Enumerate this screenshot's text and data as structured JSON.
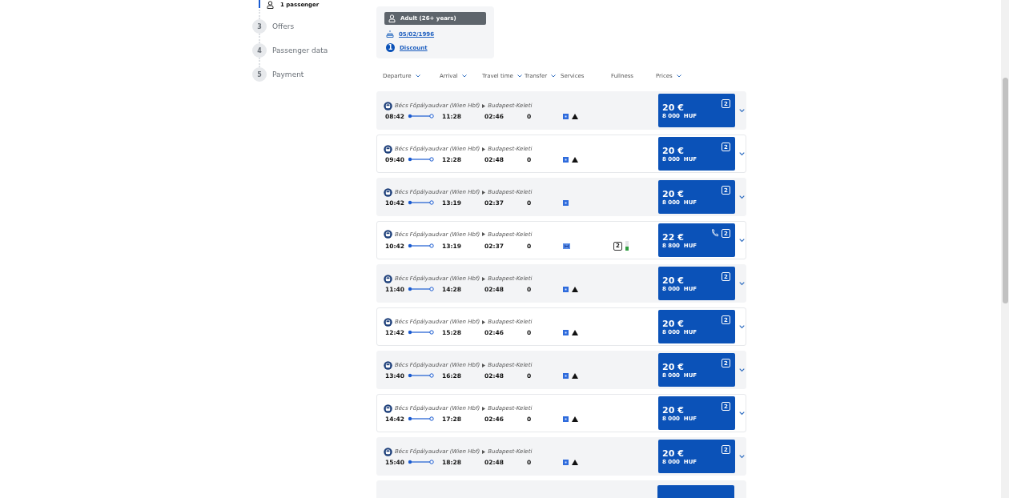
{
  "stepper": {
    "current_label": "1 passenger",
    "steps": [
      {
        "number": "3",
        "label": "Offers"
      },
      {
        "number": "4",
        "label": "Passenger data"
      },
      {
        "number": "5",
        "label": "Payment"
      }
    ]
  },
  "passenger_card": {
    "type": "Adult (26+ years)",
    "birth_date": "05/02/1996",
    "discount_count": "1",
    "discount_label": "Discount"
  },
  "columns": [
    {
      "label": "Departure",
      "sortable": true
    },
    {
      "label": "Arrival",
      "sortable": true
    },
    {
      "label": "Travel time",
      "sortable": true
    },
    {
      "label": "Transfer",
      "sortable": true
    },
    {
      "label": "Services",
      "sortable": false
    },
    {
      "label": "Fullness",
      "sortable": false
    },
    {
      "label": "Prices",
      "sortable": true
    }
  ],
  "trips": [
    {
      "from": "Bécs Főpályaudvar (Wien Hbf)",
      "to": "Budapest-Keleti",
      "departure": "08:42",
      "arrival": "11:28",
      "travel_time": "02:46",
      "transfers": "0",
      "services": [
        {
          "kind": "box"
        },
        {
          "kind": "warning"
        }
      ],
      "price": "20 €",
      "price_huf": "8 000  HUF",
      "class": "2",
      "phone": false
    },
    {
      "from": "Bécs Főpályaudvar (Wien Hbf)",
      "to": "Budapest-Keleti",
      "departure": "09:40",
      "arrival": "12:28",
      "travel_time": "02:48",
      "transfers": "0",
      "services": [
        {
          "kind": "box"
        },
        {
          "kind": "warning"
        }
      ],
      "price": "20 €",
      "price_huf": "8 000  HUF",
      "class": "2",
      "phone": false
    },
    {
      "from": "Bécs Főpályaudvar (Wien Hbf)",
      "to": "Budapest-Keleti",
      "departure": "10:42",
      "arrival": "13:19",
      "travel_time": "02:37",
      "transfers": "0",
      "services": [
        {
          "kind": "box"
        }
      ],
      "price": "20 €",
      "price_huf": "8 000  HUF",
      "class": "2",
      "phone": false
    },
    {
      "from": "Bécs Főpályaudvar (Wien Hbf)",
      "to": "Budapest-Keleti",
      "departure": "10:42",
      "arrival": "13:19",
      "travel_time": "02:37",
      "transfers": "0",
      "services": [
        {
          "kind": "couchette"
        }
      ],
      "fullness": {
        "class": "2",
        "level": 0.4
      },
      "price": "22 €",
      "price_huf": "8 800  HUF",
      "class": "2",
      "phone": true
    },
    {
      "from": "Bécs Főpályaudvar (Wien Hbf)",
      "to": "Budapest-Keleti",
      "departure": "11:40",
      "arrival": "14:28",
      "travel_time": "02:48",
      "transfers": "0",
      "services": [
        {
          "kind": "box"
        },
        {
          "kind": "warning"
        }
      ],
      "price": "20 €",
      "price_huf": "8 000  HUF",
      "class": "2",
      "phone": false
    },
    {
      "from": "Bécs Főpályaudvar (Wien Hbf)",
      "to": "Budapest-Keleti",
      "departure": "12:42",
      "arrival": "15:28",
      "travel_time": "02:46",
      "transfers": "0",
      "services": [
        {
          "kind": "box"
        },
        {
          "kind": "warning"
        }
      ],
      "price": "20 €",
      "price_huf": "8 000  HUF",
      "class": "2",
      "phone": false
    },
    {
      "from": "Bécs Főpályaudvar (Wien Hbf)",
      "to": "Budapest-Keleti",
      "departure": "13:40",
      "arrival": "16:28",
      "travel_time": "02:48",
      "transfers": "0",
      "services": [
        {
          "kind": "box"
        },
        {
          "kind": "warning"
        }
      ],
      "price": "20 €",
      "price_huf": "8 000  HUF",
      "class": "2",
      "phone": false
    },
    {
      "from": "Bécs Főpályaudvar (Wien Hbf)",
      "to": "Budapest-Keleti",
      "departure": "14:42",
      "arrival": "17:28",
      "travel_time": "02:46",
      "transfers": "0",
      "services": [
        {
          "kind": "box"
        },
        {
          "kind": "warning"
        }
      ],
      "price": "20 €",
      "price_huf": "8 000  HUF",
      "class": "2",
      "phone": false
    },
    {
      "from": "Bécs Főpályaudvar (Wien Hbf)",
      "to": "Budapest-Keleti",
      "departure": "15:40",
      "arrival": "18:28",
      "travel_time": "02:48",
      "transfers": "0",
      "services": [
        {
          "kind": "box"
        },
        {
          "kind": "warning"
        }
      ],
      "price": "20 €",
      "price_huf": "8 000  HUF",
      "class": "2",
      "phone": false
    }
  ]
}
